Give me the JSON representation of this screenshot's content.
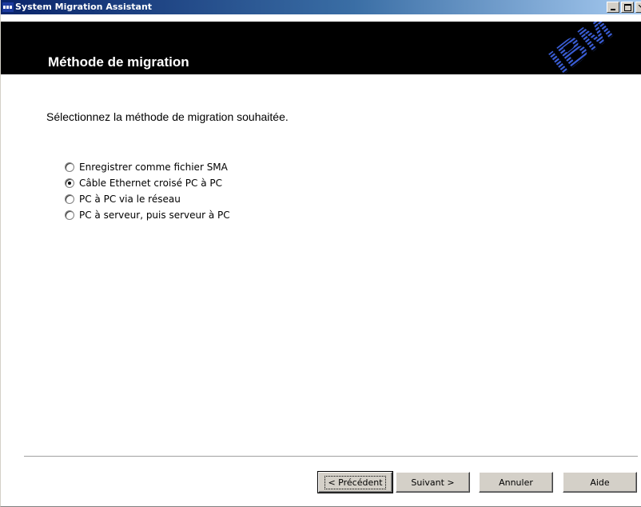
{
  "window": {
    "title": "System Migration Assistant"
  },
  "header": {
    "title": "Méthode de migration",
    "logo": "IBM"
  },
  "content": {
    "prompt": "Sélectionnez la méthode de migration souhaitée.",
    "options": [
      {
        "label": "Enregistrer comme fichier SMA",
        "selected": false
      },
      {
        "label": "Câble Ethernet croisé PC à PC",
        "selected": true
      },
      {
        "label": "PC à PC via le réseau",
        "selected": false
      },
      {
        "label": "PC à serveur, puis serveur à PC",
        "selected": false
      }
    ]
  },
  "footer": {
    "back": "< Précédent",
    "next": "Suivant >",
    "cancel": "Annuler",
    "help": "Aide"
  }
}
